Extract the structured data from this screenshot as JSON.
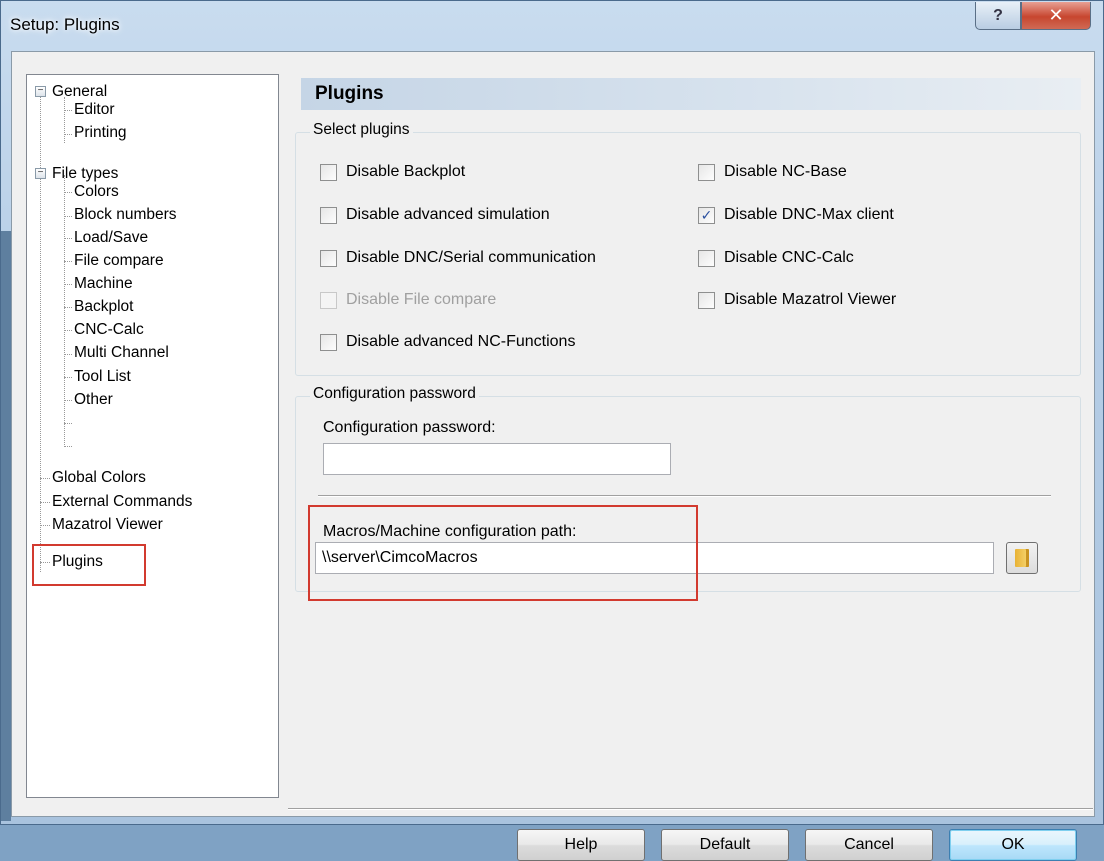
{
  "window": {
    "title": "Setup: Plugins",
    "help_glyph": "?",
    "close_glyph": "✕"
  },
  "tree": {
    "items": [
      {
        "label": "General"
      },
      {
        "label": "Editor"
      },
      {
        "label": "Printing"
      },
      {
        "label": "File types"
      },
      {
        "label": "Colors"
      },
      {
        "label": "Block numbers"
      },
      {
        "label": "Load/Save"
      },
      {
        "label": "File compare"
      },
      {
        "label": "Machine"
      },
      {
        "label": "Backplot"
      },
      {
        "label": "CNC-Calc"
      },
      {
        "label": "Multi Channel"
      },
      {
        "label": "Tool List"
      },
      {
        "label": "Other"
      },
      {
        "label": "Global Colors"
      },
      {
        "label": "External Commands"
      },
      {
        "label": "Mazatrol Viewer"
      },
      {
        "label": "Plugins"
      }
    ],
    "collapse_glyph": "−"
  },
  "panel": {
    "header": "Plugins",
    "select_group_label": "Select plugins",
    "checkboxes": [
      {
        "label": "Disable Backplot",
        "checked": false,
        "enabled": true
      },
      {
        "label": "Disable advanced simulation",
        "checked": false,
        "enabled": true
      },
      {
        "label": "Disable DNC/Serial communication",
        "checked": false,
        "enabled": true
      },
      {
        "label": "Disable File compare",
        "checked": false,
        "enabled": false
      },
      {
        "label": "Disable advanced NC-Functions",
        "checked": false,
        "enabled": true
      },
      {
        "label": "Disable NC-Base",
        "checked": false,
        "enabled": true
      },
      {
        "label": "Disable DNC-Max client",
        "checked": true,
        "enabled": true
      },
      {
        "label": "Disable CNC-Calc",
        "checked": false,
        "enabled": true
      },
      {
        "label": "Disable Mazatrol Viewer",
        "checked": false,
        "enabled": true
      }
    ],
    "check_glyph": "✓",
    "password_group_label": "Configuration password",
    "password_label": "Configuration password:",
    "password_value": "",
    "macros_label": "Macros/Machine configuration path:",
    "macros_value": "\\\\server\\CimcoMacros"
  },
  "buttons": {
    "help": "Help",
    "default": "Default",
    "cancel": "Cancel",
    "ok": "OK"
  },
  "colors": {
    "highlight_border": "#d23a2f",
    "checkmark": "#2a4f9e"
  }
}
